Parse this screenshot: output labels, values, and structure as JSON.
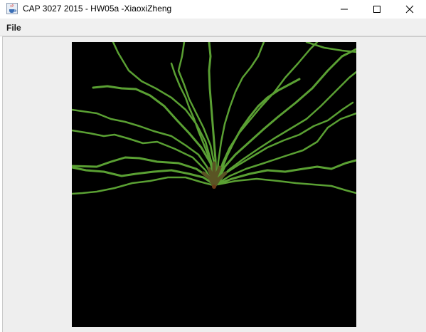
{
  "window": {
    "title": "CAP 3027 2015 - HW05a -XiaoxiZheng",
    "icons": {
      "app": "java-cup-icon",
      "minimize": "minimize-icon",
      "maximize": "maximize-icon",
      "close": "close-icon"
    }
  },
  "menu": {
    "items": [
      {
        "label": "File"
      }
    ]
  },
  "canvas": {
    "background": "#000000",
    "tree_base_color": "#6a3a18",
    "tree_tip_color": "#5aa033"
  }
}
